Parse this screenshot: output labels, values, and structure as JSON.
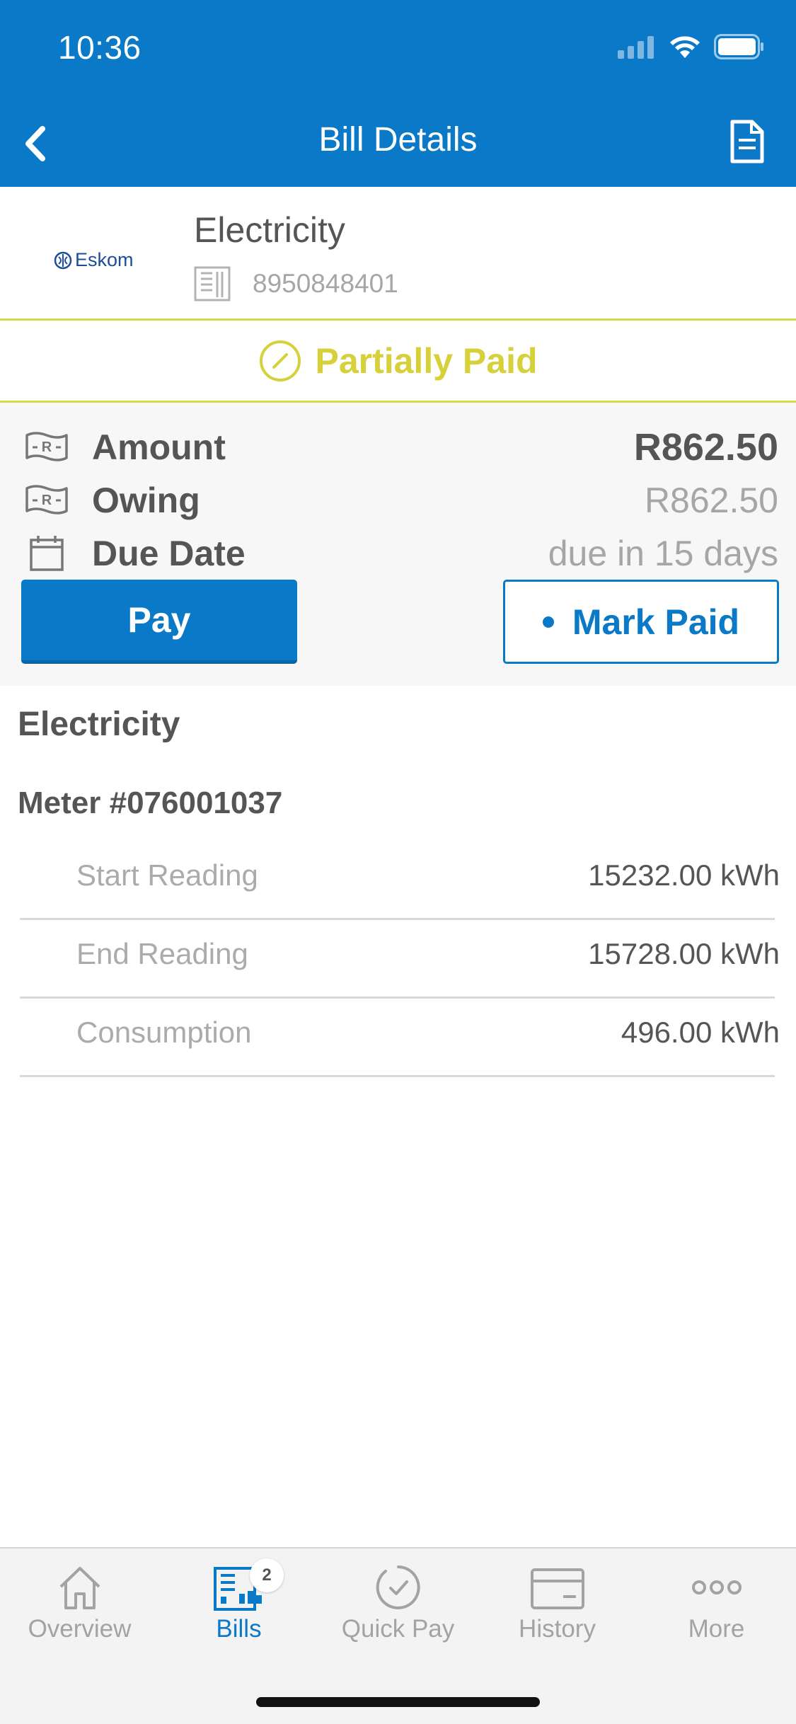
{
  "status_bar": {
    "time": "10:36"
  },
  "header": {
    "title": "Bill Details"
  },
  "biller": {
    "logo_text": "Eskom",
    "name": "Electricity",
    "account_number": "8950848401"
  },
  "status": {
    "label": "Partially Paid",
    "color": "#d6d13a"
  },
  "summary": {
    "amount_label": "Amount",
    "amount_value": "R862.50",
    "owing_label": "Owing",
    "owing_value": "R862.50",
    "due_label": "Due Date",
    "due_value": "due in 15 days"
  },
  "actions": {
    "pay_label": "Pay",
    "mark_paid_label": "Mark Paid"
  },
  "details": {
    "section_title": "Electricity",
    "meter_title": "Meter #076001037",
    "readings": [
      {
        "label": "Start Reading",
        "value": "15232.00 kWh"
      },
      {
        "label": "End Reading",
        "value": "15728.00 kWh"
      },
      {
        "label": "Consumption",
        "value": "496.00 kWh"
      }
    ]
  },
  "tabbar": {
    "tabs": [
      {
        "label": "Overview",
        "icon": "home-icon"
      },
      {
        "label": "Bills",
        "icon": "bills-icon",
        "badge": "2",
        "active": true
      },
      {
        "label": "Quick Pay",
        "icon": "quick-pay-icon"
      },
      {
        "label": "History",
        "icon": "card-icon"
      },
      {
        "label": "More",
        "icon": "more-icon"
      }
    ]
  },
  "colors": {
    "primary": "#0a7ac8",
    "status_yellow": "#d6d13a",
    "text": "#555555",
    "muted": "#a6a6a6"
  }
}
